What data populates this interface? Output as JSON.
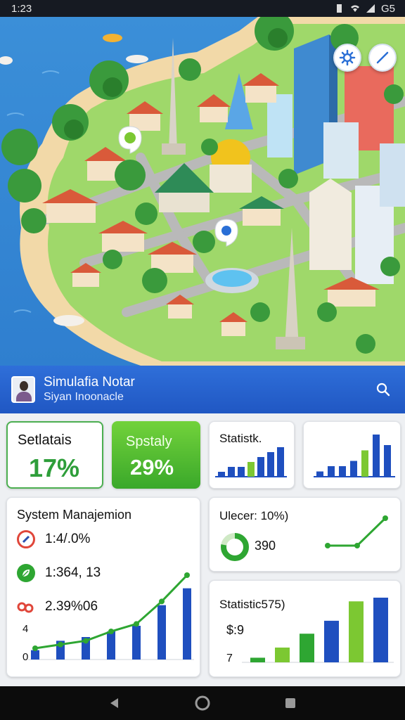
{
  "status_bar": {
    "time": "1:23",
    "battery": "G5"
  },
  "map": {
    "settings_icon": "gear-icon",
    "edit_icon": "pencil-icon"
  },
  "header": {
    "title": "Simulafia Notar",
    "subtitle": "Siyan Inoonacle",
    "search_icon": "search-icon"
  },
  "stats": [
    {
      "label": "Setlatais",
      "value": "17%"
    },
    {
      "label": "Spstaly",
      "value": "29%"
    }
  ],
  "mini_charts": [
    {
      "label": "Statistk.",
      "values": [
        1,
        2,
        2,
        3,
        4,
        5,
        6
      ],
      "colors": [
        "#1f4fbf",
        "#1f4fbf",
        "#1f4fbf",
        "#7cc832",
        "#1f4fbf",
        "#1f4fbf",
        "#1f4fbf"
      ]
    },
    {
      "label": "",
      "values": [
        1,
        2,
        2,
        3,
        5,
        8,
        6
      ],
      "colors": [
        "#1f4fbf",
        "#1f4fbf",
        "#1f4fbf",
        "#1f4fbf",
        "#7cc832",
        "#1f4fbf",
        "#1f4fbf"
      ]
    }
  ],
  "system": {
    "title": "System Manajemion",
    "rows": [
      {
        "icon": "gauge-icon",
        "text": "1:4/.0%"
      },
      {
        "icon": "leaf-icon",
        "text": "1:364, 13"
      },
      {
        "icon": "link-icon",
        "text": "2.39%06"
      }
    ],
    "axis_labels": [
      "4",
      "0"
    ],
    "chart": {
      "bars": [
        1,
        2,
        2.4,
        3,
        3.6,
        5.8,
        7.6
      ],
      "line": [
        1.2,
        1.6,
        2,
        3,
        3.8,
        6.2,
        9
      ]
    }
  },
  "usage": {
    "title": "Ulecer: 10%)",
    "value": "390",
    "donut_fraction": 0.78,
    "trend": [
      0.2,
      0.2,
      0.85
    ]
  },
  "stat_card": {
    "title": "Statistic575)",
    "value": "$:9",
    "tick": "7",
    "values": [
      0.5,
      1.6,
      3.1,
      4.5,
      6.6,
      7.0
    ],
    "colors": [
      "#2ea632",
      "#7cc832",
      "#2ea632",
      "#1f4fbf",
      "#7cc832",
      "#1f4fbf"
    ]
  },
  "colors": {
    "header": "#2a63d0",
    "accent_green": "#4caf50",
    "bar_blue": "#1f4fbf"
  }
}
